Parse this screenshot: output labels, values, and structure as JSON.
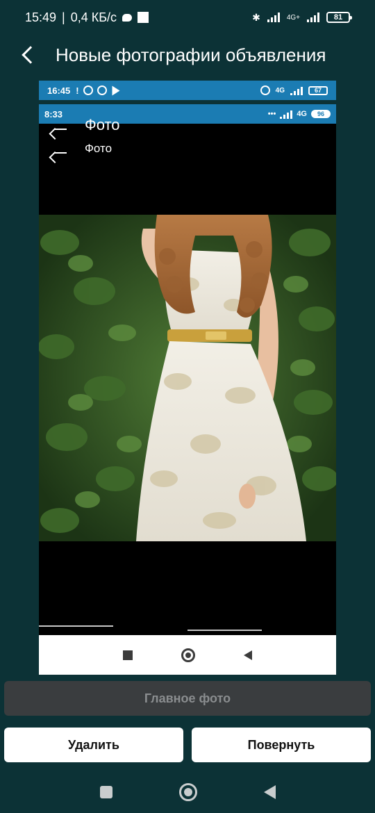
{
  "status_bar": {
    "time": "15:49",
    "speed": "0,4 КБ/с",
    "network": "4G+",
    "battery": "81"
  },
  "header": {
    "title": "Новые фотографии объявления"
  },
  "embedded_screenshot": {
    "status_1": {
      "time": "16:45",
      "network": "4G",
      "battery": "67"
    },
    "status_2": {
      "time": "8:33",
      "network": "4G",
      "battery": "96"
    },
    "appbar_1_title": "Фото",
    "appbar_2_title": "Фото"
  },
  "buttons": {
    "main_photo": "Главное фото",
    "delete": "Удалить",
    "rotate": "Повернуть"
  },
  "colors": {
    "background": "#0c3236",
    "inner_status": "#1b7cb3",
    "disabled_button": "#3a3d3f"
  }
}
